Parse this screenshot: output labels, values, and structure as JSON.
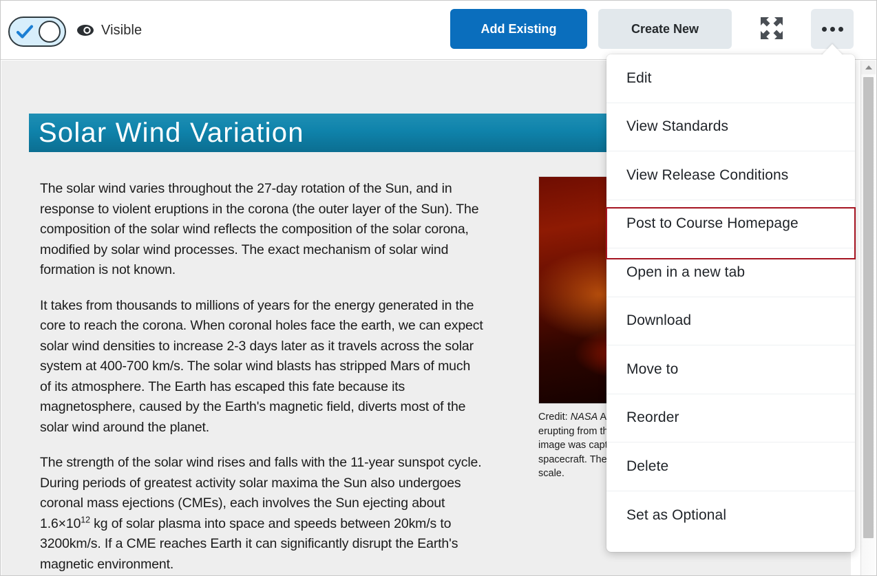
{
  "toolbar": {
    "toggle": {
      "name": "visibility-toggle",
      "state": "on"
    },
    "visibility_label": "Visible",
    "eye_icon": "eye-icon",
    "add_existing_label": "Add Existing",
    "create_new_label": "Create New",
    "expand_icon": "expand-icon",
    "more_icon": "more-options-icon"
  },
  "menu": {
    "items": [
      {
        "label": "Edit",
        "highlighted": false
      },
      {
        "label": "View Standards",
        "highlighted": false
      },
      {
        "label": "View Release Conditions",
        "highlighted": false
      },
      {
        "label": "Post to Course Homepage",
        "highlighted": true
      },
      {
        "label": "Open in a new tab",
        "highlighted": false
      },
      {
        "label": "Download",
        "highlighted": false
      },
      {
        "label": "Move to",
        "highlighted": false
      },
      {
        "label": "Reorder",
        "highlighted": false
      },
      {
        "label": "Delete",
        "highlighted": false
      },
      {
        "label": "Set as Optional",
        "highlighted": false
      }
    ]
  },
  "content": {
    "title": "Solar  Wind  Variation",
    "paragraphs": [
      "The solar wind varies throughout the 27-day rotation of the Sun, and in response to violent eruptions in the corona (the outer layer of the Sun). The composition of the solar wind reflects the composition of the solar corona, modified by solar wind processes. The exact mechanism of solar wind formation is not known.",
      "It takes from thousands to millions of years for the energy generated in the core to reach the corona. When coronal holes face the earth, we can expect solar wind densities to increase 2-3 days later as it travels across the solar system at 400-700 km/s. The solar wind blasts has stripped Mars of much of its atmosphere. The Earth has escaped this fate because its magnetosphere, caused by the Earth's magnetic field, diverts most of the solar wind around the planet."
    ],
    "paragraph3": {
      "before": "The strength of the solar wind rises and falls with the 11-year sunspot cycle. During periods of greatest activity  solar maxima  the Sun also undergoes coronal mass ejections (CMEs), each involves the Sun ejecting about 1.6×10",
      "superscript": "12",
      "after": " kg of solar plasma into space and speeds between 20km/s to 3200km/s. If a CME reaches Earth it can significantly disrupt the Earth's magnetic environment."
    },
    "figure": {
      "alt": "solar-prominence-image",
      "caption_credit_prefix": "Credit: ",
      "caption_credit_source": "NASA",
      "caption_text": " A coronal mass ejection erupting from the Sun's surface. This image was captured by the SOHO spacecraft. The Earth is shown to scale."
    }
  },
  "scrollbar": {
    "up_arrow_icon": "scroll-up-arrow-icon",
    "thumb": "scroll-thumb"
  },
  "colors": {
    "primary_blue": "#0a6ebd",
    "secondary_gray": "#e2e8ec",
    "banner_teal": "#0f83ab",
    "highlight_red": "#a51320",
    "content_bg": "#eeeeee"
  }
}
